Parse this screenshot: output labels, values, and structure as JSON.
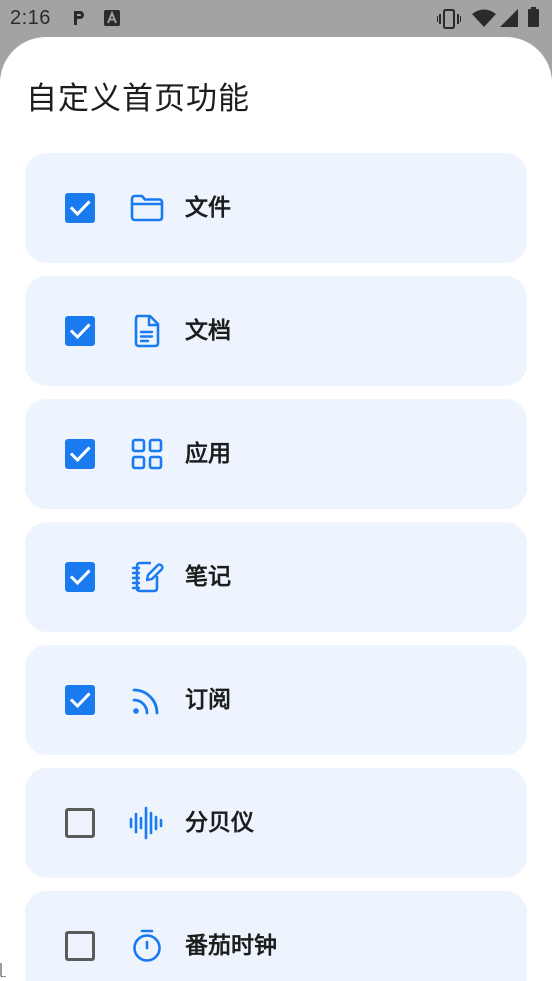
{
  "status_bar": {
    "time": "2:16",
    "icons": [
      "p-icon",
      "a-icon",
      "vibrate-icon",
      "wifi-icon",
      "signal-icon",
      "battery-icon"
    ]
  },
  "sheet": {
    "title": "自定义首页功能",
    "items": [
      {
        "label": "文件",
        "checked": true,
        "icon": "folder-icon"
      },
      {
        "label": "文档",
        "checked": true,
        "icon": "document-icon"
      },
      {
        "label": "应用",
        "checked": true,
        "icon": "apps-grid-icon"
      },
      {
        "label": "笔记",
        "checked": true,
        "icon": "notebook-icon"
      },
      {
        "label": "订阅",
        "checked": true,
        "icon": "rss-icon"
      },
      {
        "label": "分贝仪",
        "checked": false,
        "icon": "sound-wave-icon"
      },
      {
        "label": "番茄时钟",
        "checked": false,
        "icon": "stopwatch-icon"
      }
    ]
  },
  "colors": {
    "accent": "#1a7af0",
    "item_background": "#edf4fe",
    "scrim": "#a3a3a3"
  }
}
